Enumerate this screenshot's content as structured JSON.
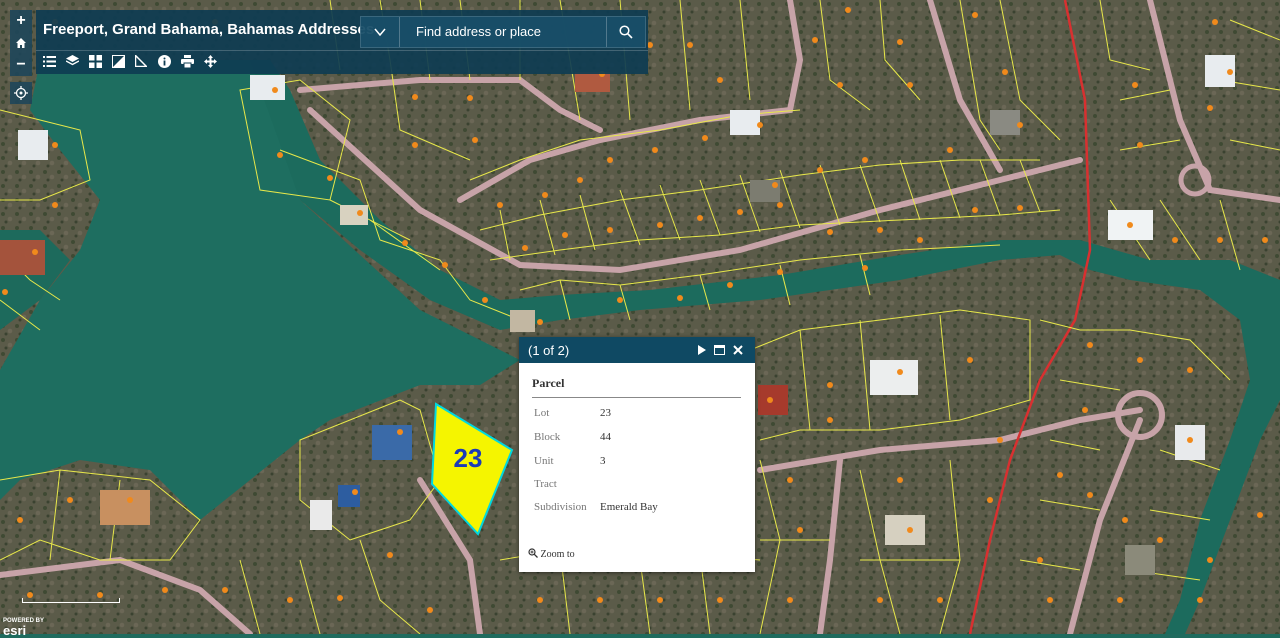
{
  "header": {
    "title": "Freeport, Grand Bahama, Bahamas Addresses",
    "search_placeholder": "Find address or place"
  },
  "map_controls": {
    "zoom_in": "+",
    "home_icon": "home-icon",
    "zoom_out": "−",
    "locate_icon": "locate-icon"
  },
  "toolbar": {
    "tools": [
      "legend-icon",
      "layers-icon",
      "basemap-gallery-icon",
      "swipe-icon",
      "measure-icon",
      "info-icon",
      "print-icon",
      "directions-icon"
    ]
  },
  "parcel_label": "23",
  "popup": {
    "count": "(1 of 2)",
    "title": "Parcel",
    "fields": [
      {
        "label": "Lot",
        "value": "23"
      },
      {
        "label": "Block",
        "value": "44"
      },
      {
        "label": "Unit",
        "value": "3"
      },
      {
        "label": "Tract",
        "value": ""
      },
      {
        "label": "Subdivision",
        "value": "Emerald Bay"
      }
    ],
    "zoom_to": "Zoom to"
  },
  "attribution": {
    "powered_by": "POWERED BY",
    "logo": "esri"
  },
  "colors": {
    "header_bg": "#0e3c52",
    "water": "#1f6b5e",
    "land": "#5a5a48",
    "parcel_line": "#e8e84a",
    "road": "#c9a8a8",
    "highway": "#d83030",
    "selected_parcel": "#f5f500",
    "selected_outline": "#00d8e0",
    "marker": "#f08a1c"
  }
}
